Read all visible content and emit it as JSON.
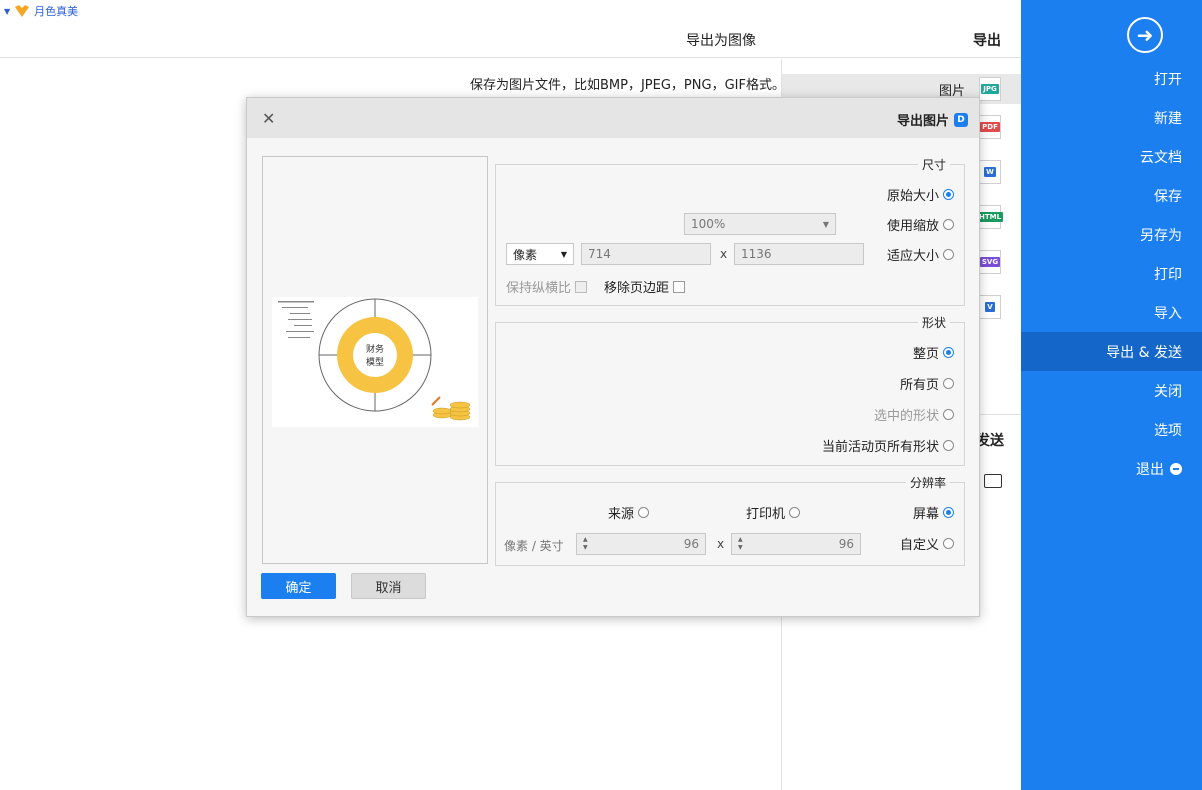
{
  "topbar": {
    "user_name": "月色真美"
  },
  "header": {
    "section_title": "导出",
    "subsection_title": "导出为图像"
  },
  "description": "保存为图片文件，比如BMP，JPEG，PNG，GIF格式。",
  "formats": [
    {
      "label": "图片",
      "badge": "JPG",
      "color": "#20a99a"
    },
    {
      "label": "",
      "badge": "PDF",
      "color": "#e04b4b"
    },
    {
      "label": "",
      "badge": "W",
      "color": "#2b6dd6"
    },
    {
      "label": "",
      "badge": "HTML",
      "color": "#1d9a5e"
    },
    {
      "label": "",
      "badge": "SVG",
      "color": "#7a4fd6"
    },
    {
      "label": "",
      "badge": "V",
      "color": "#2b6dd6"
    }
  ],
  "send_label": "发送",
  "sidebar": {
    "items": [
      {
        "label": "打开"
      },
      {
        "label": "新建"
      },
      {
        "label": "云文档"
      },
      {
        "label": "保存"
      },
      {
        "label": "另存为"
      },
      {
        "label": "打印"
      },
      {
        "label": "导入"
      },
      {
        "label": "导出 & 发送"
      },
      {
        "label": "关闭"
      },
      {
        "label": "选项"
      },
      {
        "label": "退出"
      }
    ]
  },
  "dialog": {
    "title": "导出图片",
    "size_group": {
      "legend": "尺寸",
      "original": "原始大小",
      "scale": "使用缩放",
      "scale_value": "100%",
      "fit": "适应大小",
      "width": "1136",
      "height": "714",
      "unit": "像素",
      "remove_margin": "移除页边距",
      "keep_ratio": "保持纵横比"
    },
    "shape_group": {
      "legend": "形状",
      "whole_page": "整页",
      "all_pages": "所有页",
      "selected": "选中的形状",
      "all_active": "当前活动页所有形状"
    },
    "dpi_group": {
      "legend": "分辨率",
      "screen": "屏幕",
      "printer": "打印机",
      "source": "来源",
      "custom": "自定义",
      "dpi_x": "96",
      "dpi_y": "96",
      "dpi_unit": "像素 / 英寸"
    },
    "ok": "确定",
    "cancel": "取消"
  },
  "preview_chart": {
    "center_top": "财务",
    "center_bottom": "模型"
  },
  "colors": {
    "accent": "#1b7ff0",
    "accent_dark": "#1467c9",
    "donut": "#f6c343"
  }
}
